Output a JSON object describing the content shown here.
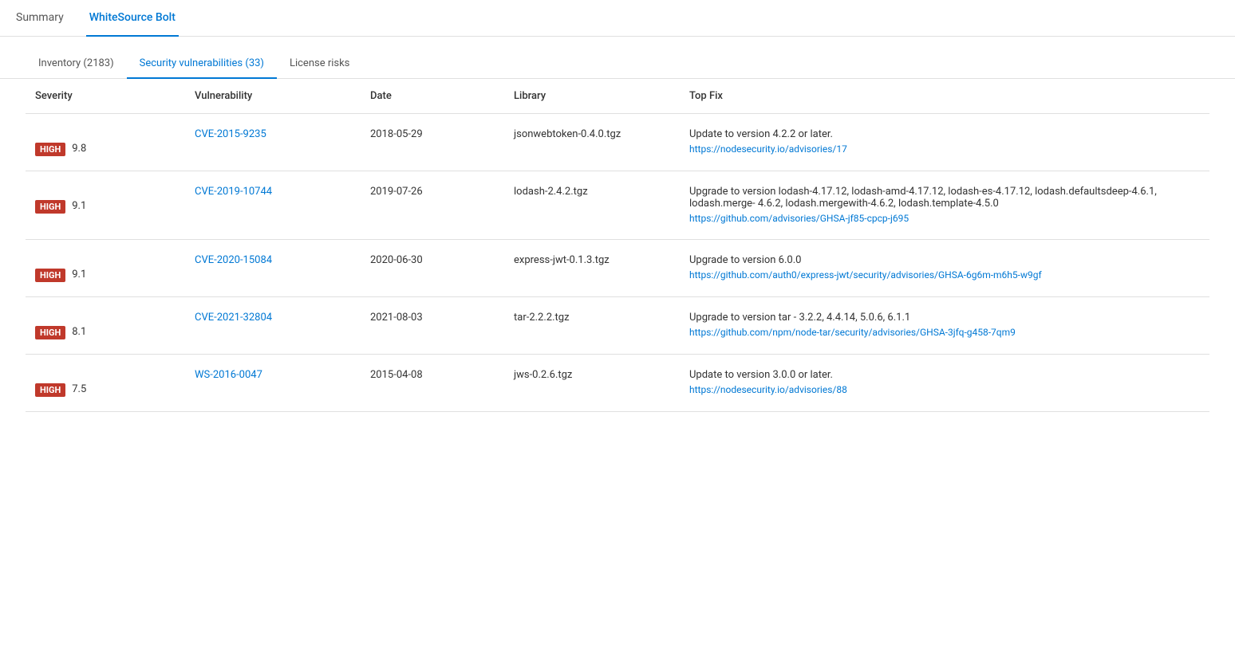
{
  "topTabs": [
    {
      "id": "summary",
      "label": "Summary",
      "active": false
    },
    {
      "id": "whitesource-bolt",
      "label": "WhiteSource Bolt",
      "active": true
    }
  ],
  "subTabs": [
    {
      "id": "inventory",
      "label": "Inventory (2183)",
      "active": false
    },
    {
      "id": "security-vulnerabilities",
      "label": "Security vulnerabilities (33)",
      "active": true
    },
    {
      "id": "license-risks",
      "label": "License risks",
      "active": false
    }
  ],
  "table": {
    "columns": [
      {
        "id": "severity",
        "label": "Severity"
      },
      {
        "id": "vulnerability",
        "label": "Vulnerability"
      },
      {
        "id": "date",
        "label": "Date"
      },
      {
        "id": "library",
        "label": "Library"
      },
      {
        "id": "topfix",
        "label": "Top Fix"
      }
    ],
    "rows": [
      {
        "severity_label": "HIGH",
        "severity_score": "9.8",
        "vulnerability": "CVE-2015-9235",
        "date": "2018-05-29",
        "library": "jsonwebtoken-0.4.0.tgz",
        "topfix_text": "Update to version 4.2.2 or later.",
        "topfix_link": "https://nodesecurity.io/advisories/17"
      },
      {
        "severity_label": "HIGH",
        "severity_score": "9.1",
        "vulnerability": "CVE-2019-10744",
        "date": "2019-07-26",
        "library": "lodash-2.4.2.tgz",
        "topfix_text": "Upgrade to version lodash-4.17.12, lodash-amd-4.17.12, lodash-es-4.17.12, lodash.defaultsdeep-4.6.1, lodash.merge- 4.6.2, lodash.mergewith-4.6.2, lodash.template-4.5.0",
        "topfix_link": "https://github.com/advisories/GHSA-jf85-cpcp-j695"
      },
      {
        "severity_label": "HIGH",
        "severity_score": "9.1",
        "vulnerability": "CVE-2020-15084",
        "date": "2020-06-30",
        "library": "express-jwt-0.1.3.tgz",
        "topfix_text": "Upgrade to version 6.0.0",
        "topfix_link": "https://github.com/auth0/express-jwt/security/advisories/GHSA-6g6m-m6h5-w9gf"
      },
      {
        "severity_label": "HIGH",
        "severity_score": "8.1",
        "vulnerability": "CVE-2021-32804",
        "date": "2021-08-03",
        "library": "tar-2.2.2.tgz",
        "topfix_text": "Upgrade to version tar - 3.2.2, 4.4.14, 5.0.6, 6.1.1",
        "topfix_link": "https://github.com/npm/node-tar/security/advisories/GHSA-3jfq-g458-7qm9"
      },
      {
        "severity_label": "HIGH",
        "severity_score": "7.5",
        "vulnerability": "WS-2016-0047",
        "date": "2015-04-08",
        "library": "jws-0.2.6.tgz",
        "topfix_text": "Update to version 3.0.0 or later.",
        "topfix_link": "https://nodesecurity.io/advisories/88"
      }
    ]
  }
}
